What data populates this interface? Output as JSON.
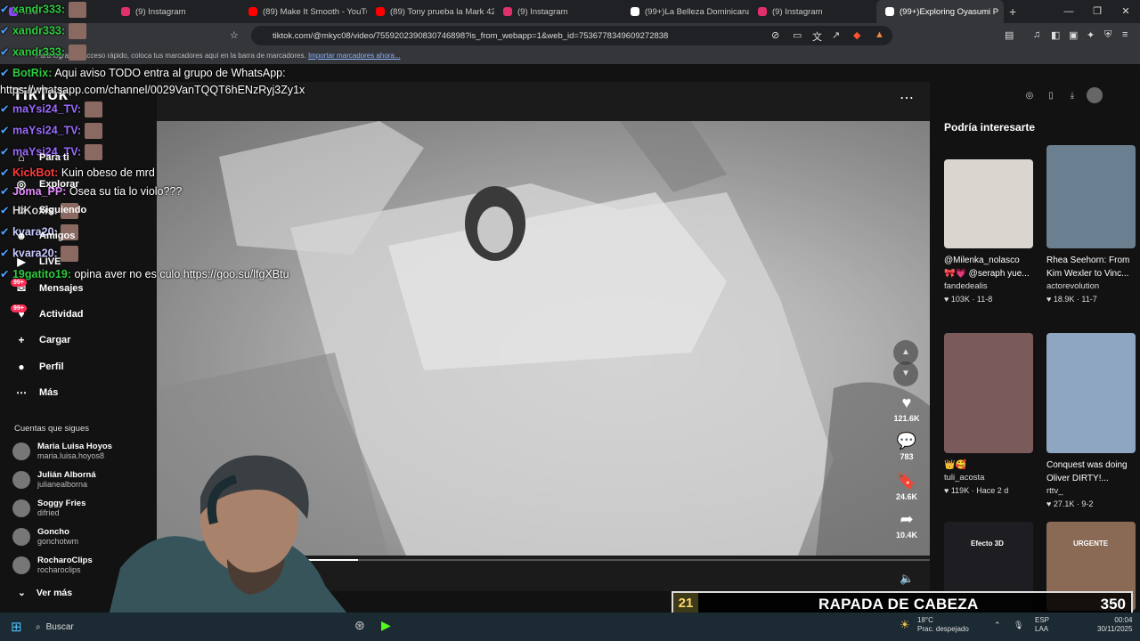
{
  "browser": {
    "tabs": [
      {
        "label": "...rd",
        "color": "#9146ff",
        "active": false
      },
      {
        "label": "(9) Instagram",
        "color": "#e1306c",
        "active": false
      },
      {
        "label": "(89) Make It Smooth - YouTube",
        "color": "#ff0000",
        "active": false
      },
      {
        "label": "(89) Tony prueba la Mark 42 #",
        "color": "#ff0000",
        "active": false
      },
      {
        "label": "(9) Instagram",
        "color": "#e1306c",
        "active": false
      },
      {
        "label": "(99+)La Belleza Dominicana en",
        "color": "#ffffff",
        "active": false
      },
      {
        "label": "(9) Instagram",
        "color": "#e1306c",
        "active": false
      },
      {
        "label": "(99+)Exploring Oyasumi P",
        "color": "#ffffff",
        "active": true
      }
    ],
    "url": "tiktok.com/@mkyc08/video/7559202390830746898?is_from_webapp=1&web_id=7536778349609272838",
    "bookmark_hint": "Para lograr un acceso rápido, coloca tus marcadores aquí en la barra de marcadores.",
    "bookmark_link": "Importar marcadores ahora..."
  },
  "tiktok": {
    "logo": "TikTok",
    "nav": [
      {
        "label": "Para ti",
        "icon": "⌂"
      },
      {
        "label": "Explorar",
        "icon": "◎"
      },
      {
        "label": "Siguiendo",
        "icon": "☺"
      },
      {
        "label": "Amigos",
        "icon": "☻"
      },
      {
        "label": "LIVE",
        "icon": "▶"
      },
      {
        "label": "Mensajes",
        "icon": "✉"
      },
      {
        "label": "Actividad",
        "icon": "♥"
      },
      {
        "label": "Cargar",
        "icon": "+"
      },
      {
        "label": "Perfil",
        "icon": "●"
      },
      {
        "label": "Más",
        "icon": "⋯"
      }
    ],
    "badge": "99+",
    "following_header": "Cuentas que sigues",
    "following": [
      {
        "name": "Maria Luisa Hoyos",
        "user": "maria.luisa.hoyos8"
      },
      {
        "name": "Julián Alborná",
        "user": "julianealborna"
      },
      {
        "name": "Soggy Fries",
        "user": "difried"
      },
      {
        "name": "Goncho",
        "user": "gonchotwm"
      },
      {
        "name": "RocharoClips",
        "user": "rocharoclips"
      }
    ],
    "see_more": "Ver más",
    "actions": {
      "likes": "121.6K",
      "comments": "783",
      "saves": "24.6K",
      "shares": "10.4K"
    },
    "progress": 0.26,
    "recommend_title": "Podría interesarte",
    "cards": [
      {
        "title": "@Milenka_nolasco",
        "title2": "🎀💗 @seraph yue...",
        "user": "fandedealis",
        "stats": "♥ 103K · 11-8",
        "color": "#d9d6d0"
      },
      {
        "title": "Rhea Seehorn: From",
        "title2": "Kim Wexler to Vinc...",
        "user": "actorevolution",
        "stats": "♥ 18.9K · 11-7",
        "color": "#6a7f8f"
      },
      {
        "title": "👑🥰",
        "title2": "",
        "user": "tuli_acosta",
        "stats": "♥ 119K · Hace 2 d",
        "color": "#7a5a5a"
      },
      {
        "title": "Conquest was doing",
        "title2": "Oliver DIRTY!...",
        "user": "rttv_",
        "stats": "♥ 27.1K · 9-2",
        "color": "#8fa6c2"
      },
      {
        "title": "",
        "title2": "",
        "user": "",
        "stats": "",
        "color": "#1e1e22",
        "label": "Efecto 3D"
      },
      {
        "title": "",
        "title2": "",
        "user": "",
        "stats": "",
        "color": "#8a6a55",
        "label": "URGENTE"
      }
    ]
  },
  "chat": [
    {
      "user": "xandr333:",
      "color": "#2ecc40",
      "text": ""
    },
    {
      "user": "xandr333:",
      "color": "#2ecc40",
      "text": ""
    },
    {
      "user": "xandr333:",
      "color": "#2ecc40",
      "text": ""
    },
    {
      "user": "BotRix:",
      "color": "#2ecc40",
      "text": "Aqui aviso TODO entra al grupo de WhatsApp:"
    },
    {
      "user": "",
      "color": "#ffffff",
      "text": "https://whatsapp.com/channel/0029VanTQQT6hENzRyj3Zy1x"
    },
    {
      "user": "maYsi24_TV:",
      "color": "#9b6bff",
      "text": ""
    },
    {
      "user": "maYsi24_TV:",
      "color": "#9b6bff",
      "text": ""
    },
    {
      "user": "maYsi24_TV:",
      "color": "#9b6bff",
      "text": ""
    },
    {
      "user": "KickBot:",
      "color": "#ff3b3b",
      "text": "Kuin obeso de mrd"
    },
    {
      "user": "Joma_PP:",
      "color": "#e58cff",
      "text": "Osea su tia lo violo???"
    },
    {
      "user": "HiKoxis:",
      "color": "#d0d0d0",
      "text": ""
    },
    {
      "user": "kvara20:",
      "color": "#c8c8ff",
      "text": ""
    },
    {
      "user": "kvara20:",
      "color": "#c8c8ff",
      "text": ""
    },
    {
      "user": "19gatito19:",
      "color": "#2ecc40",
      "text": "opina aver no es culo https://goo.su/lfgXBtu"
    }
  ],
  "overlay": {
    "rank": "21",
    "title": "RAPADA DE CABEZA",
    "points": "350"
  },
  "taskbar": {
    "search": "Buscar",
    "weather_temp": "18°C",
    "weather_desc": "Prac. despejado",
    "lang1": "ESP",
    "lang2": "LAA",
    "time": "00:04",
    "date": "30/11/2025"
  }
}
